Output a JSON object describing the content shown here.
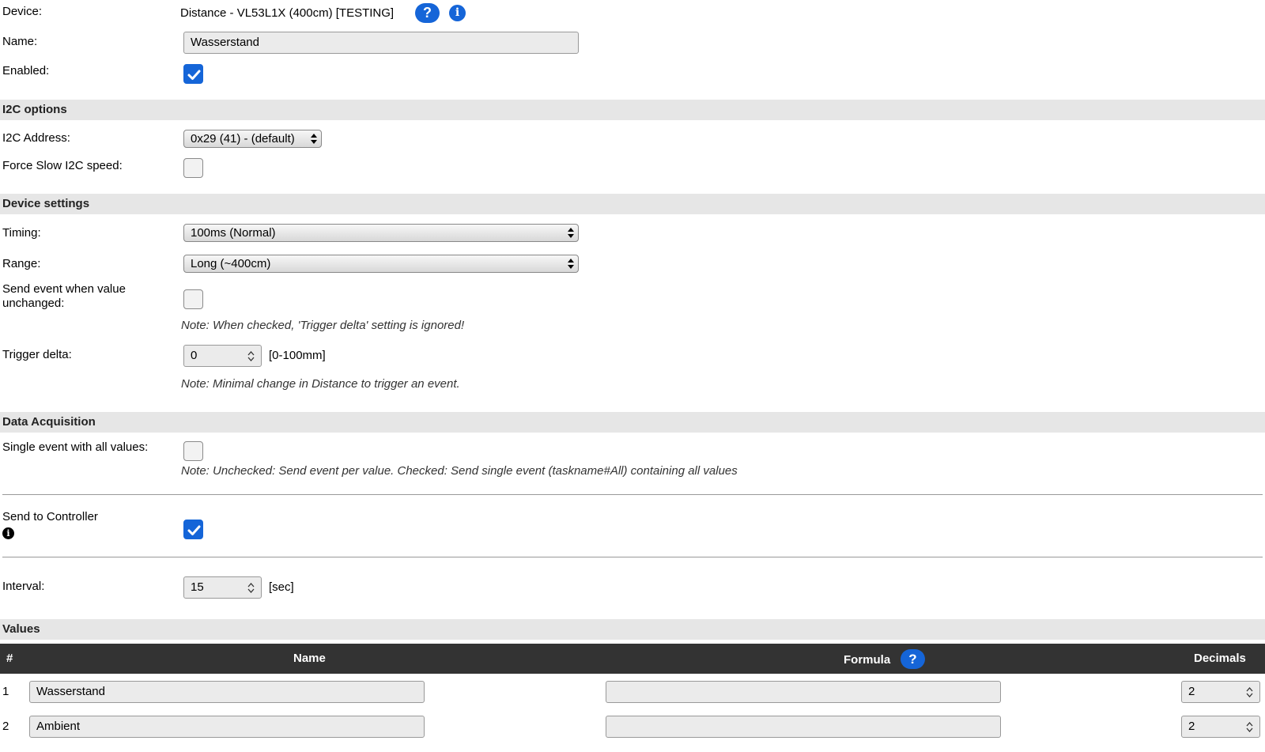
{
  "device": {
    "label": "Device:",
    "value": "Distance - VL53L1X (400cm) [TESTING]",
    "help_icon": "question-icon",
    "info_icon": "info-icon"
  },
  "name": {
    "label": "Name:",
    "value": "Wasserstand"
  },
  "enabled": {
    "label": "Enabled:",
    "checked": true
  },
  "sections": {
    "i2c": "I2C options",
    "device_settings": "Device settings",
    "data_acquisition": "Data Acquisition",
    "values": "Values"
  },
  "i2c_address": {
    "label": "I2C Address:",
    "value": "0x29 (41) - (default)"
  },
  "force_slow": {
    "label": "Force Slow I2C speed:",
    "checked": false
  },
  "timing": {
    "label": "Timing:",
    "value": "100ms (Normal)"
  },
  "range": {
    "label": "Range:",
    "value": "Long (~400cm)"
  },
  "send_unchanged": {
    "label_line1": "Send event when value",
    "label_line2": "unchanged:",
    "checked": false,
    "note": "Note: When checked, 'Trigger delta' setting is ignored!"
  },
  "trigger_delta": {
    "label": "Trigger delta:",
    "value": "0",
    "unit": "[0-100mm]",
    "note": "Note: Minimal change in Distance to trigger an event."
  },
  "single_event": {
    "label": "Single event with all values:",
    "checked": false,
    "note": "Note: Unchecked: Send event per value. Checked: Send single event (taskname#All) containing all values"
  },
  "send_controller": {
    "label": "Send to Controller",
    "icon_glyph": "i",
    "checked": true
  },
  "interval": {
    "label": "Interval:",
    "value": "15",
    "unit": "[sec]"
  },
  "table": {
    "headers": {
      "num": "#",
      "name": "Name",
      "formula": "Formula",
      "decimals": "Decimals"
    },
    "formula_help": "?",
    "rows": [
      {
        "num": "1",
        "name": "Wasserstand",
        "formula": "",
        "decimals": "2"
      },
      {
        "num": "2",
        "name": "Ambient",
        "formula": "",
        "decimals": "2"
      }
    ]
  },
  "colors": {
    "accent": "#1565d8",
    "section_bg": "#e6e6e6",
    "table_header_bg": "#333333"
  }
}
